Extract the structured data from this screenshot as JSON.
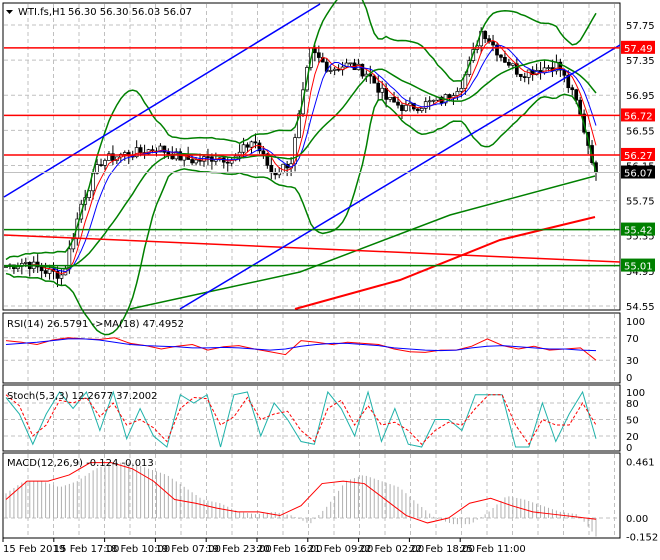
{
  "header": {
    "symbol_label": "WTI.fs,H1",
    "ohlc": "56.30 56.30 56.03 56.07"
  },
  "chart_data": {
    "type": "candlestick",
    "symbol": "WTI.fs",
    "timeframe": "H1",
    "ylim": [
      54.5,
      57.85
    ],
    "price_ticks": [
      57.75,
      57.35,
      56.95,
      56.55,
      56.15,
      55.75,
      55.35,
      54.95,
      54.55
    ],
    "close_keypoints": [
      55.0,
      55.05,
      54.95,
      54.9,
      55.75,
      56.2,
      56.27,
      56.3,
      56.35,
      56.25,
      56.2,
      56.25,
      56.22,
      56.45,
      56.05,
      56.2,
      57.45,
      57.25,
      57.3,
      57.2,
      56.9,
      56.8,
      56.85,
      56.9,
      57.1,
      57.7,
      57.4,
      57.2,
      57.25,
      57.3,
      56.85,
      56.07
    ],
    "levels": [
      {
        "price": 57.49,
        "label": "57.49",
        "color": "#ff0000"
      },
      {
        "price": 56.72,
        "label": "56.72",
        "color": "#ff0000"
      },
      {
        "price": 56.27,
        "label": "56.27",
        "color": "#ff0000"
      },
      {
        "price": 55.42,
        "label": "55.42",
        "color": "#008000"
      },
      {
        "price": 55.01,
        "label": "55.01",
        "color": "#008000"
      }
    ],
    "last_price": {
      "price": 56.07,
      "label": "56.07"
    },
    "time_labels": [
      "15 Feb 2019",
      "15 Feb 17:00",
      "18 Feb 10:00",
      "19 Feb 07:00",
      "19 Feb 23:00",
      "20 Feb 16:00",
      "21 Feb 09:00",
      "22 Feb 02:00",
      "22 Feb 18:00",
      "25 Feb 11:00"
    ],
    "rsi": {
      "title": "RSI(14) 26.5791  ->MA(18) 47.4952",
      "ticks": [
        "100",
        "70",
        "30",
        "0"
      ],
      "tick_values": [
        100,
        70,
        30,
        0
      ],
      "values": [
        65,
        62,
        58,
        66,
        70,
        68,
        67,
        70,
        60,
        56,
        50,
        55,
        58,
        48,
        54,
        56,
        50,
        45,
        40,
        65,
        62,
        58,
        62,
        60,
        58,
        50,
        45,
        44,
        48,
        48,
        55,
        68,
        56,
        50,
        55,
        48,
        50,
        52,
        30
      ],
      "ma": [
        58,
        60,
        62,
        65,
        68,
        68,
        66,
        62,
        58,
        56,
        55,
        54,
        52,
        52,
        53,
        52,
        50,
        48,
        50,
        55,
        58,
        60,
        60,
        58,
        56,
        52,
        50,
        48,
        47,
        48,
        52,
        55,
        56,
        54,
        52,
        50,
        50,
        48,
        47
      ]
    },
    "stoch": {
      "title": "Stoch(5,3,3) 12.2677 37.2002",
      "ticks": [
        "100",
        "80",
        "50",
        "20",
        "0"
      ],
      "tick_values": [
        100,
        80,
        50,
        20,
        0
      ],
      "main": [
        90,
        60,
        5,
        60,
        100,
        70,
        100,
        30,
        100,
        15,
        70,
        20,
        0,
        95,
        80,
        95,
        0,
        95,
        100,
        20,
        80,
        50,
        10,
        5,
        100,
        70,
        20,
        100,
        10,
        70,
        5,
        0,
        50,
        50,
        30,
        95,
        95,
        95,
        0,
        0,
        80,
        10,
        60,
        100,
        15
      ],
      "signal": [
        95,
        75,
        20,
        40,
        85,
        80,
        90,
        55,
        80,
        40,
        50,
        35,
        10,
        70,
        90,
        88,
        40,
        55,
        90,
        50,
        60,
        65,
        30,
        10,
        70,
        85,
        40,
        75,
        40,
        45,
        30,
        5,
        30,
        45,
        40,
        70,
        95,
        95,
        40,
        5,
        50,
        40,
        40,
        80,
        40
      ]
    },
    "macd": {
      "title": "MACD(12,26,9) -0.124 -0.013",
      "ticks": [
        "0.461",
        "0.00",
        "-0.152"
      ],
      "tick_values": [
        0.461,
        0,
        -0.152
      ],
      "hist": [
        0.2,
        0.3,
        0.3,
        0.25,
        0.3,
        0.4,
        0.45,
        0.45,
        0.4,
        0.35,
        0.25,
        0.15,
        0.12,
        0.05,
        0.03,
        0.05,
        0.02,
        -0.05,
        0.1,
        0.3,
        0.35,
        0.3,
        0.25,
        0.12,
        0.0,
        -0.05,
        -0.05,
        0.05,
        0.18,
        0.15,
        0.1,
        0.05,
        0.03,
        -0.15
      ],
      "signal": [
        0.15,
        0.3,
        0.3,
        0.35,
        0.45,
        0.45,
        0.4,
        0.3,
        0.15,
        0.12,
        0.08,
        0.05,
        0.05,
        0.02,
        0.1,
        0.28,
        0.3,
        0.28,
        0.15,
        0.02,
        -0.04,
        0.0,
        0.12,
        0.16,
        0.1,
        0.05,
        0.03,
        0.01,
        -0.01
      ]
    }
  },
  "colors": {
    "candle": "#000000",
    "ma_red": "#ff0000",
    "ma_blue": "#0000ff",
    "bands": "#008000",
    "channel": "#0000ff",
    "grid": "#c0c0c0",
    "stoch": "#20b2aa"
  }
}
